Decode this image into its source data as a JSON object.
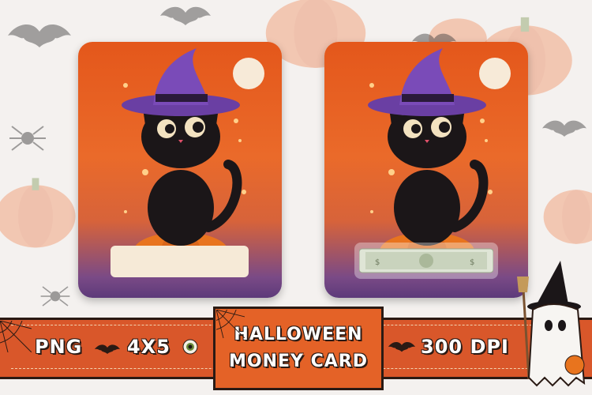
{
  "banner": {
    "format_label": "PNG",
    "size_label": "4X5",
    "title_line1": "HALLOWEEN",
    "title_line2": "MONEY CARD",
    "dpi_label": "300 DPI"
  },
  "cards": [
    {
      "name": "blank card",
      "variant": "label-box"
    },
    {
      "name": "card with money",
      "variant": "bill"
    }
  ],
  "colors": {
    "banner": "#d9572a",
    "card_orange": "#e4571b",
    "card_purple": "#5d3a7a",
    "hat_purple": "#6a3fa3",
    "cream": "#f6ead7",
    "outline": "#2a1a14"
  },
  "icons": [
    "bat-icon",
    "spider-icon",
    "pumpkin-icon",
    "eyeball-icon",
    "ghost-icon",
    "cat-icon",
    "witch-hat-icon",
    "broom-icon",
    "cobweb-icon",
    "dollar-bill-icon"
  ]
}
